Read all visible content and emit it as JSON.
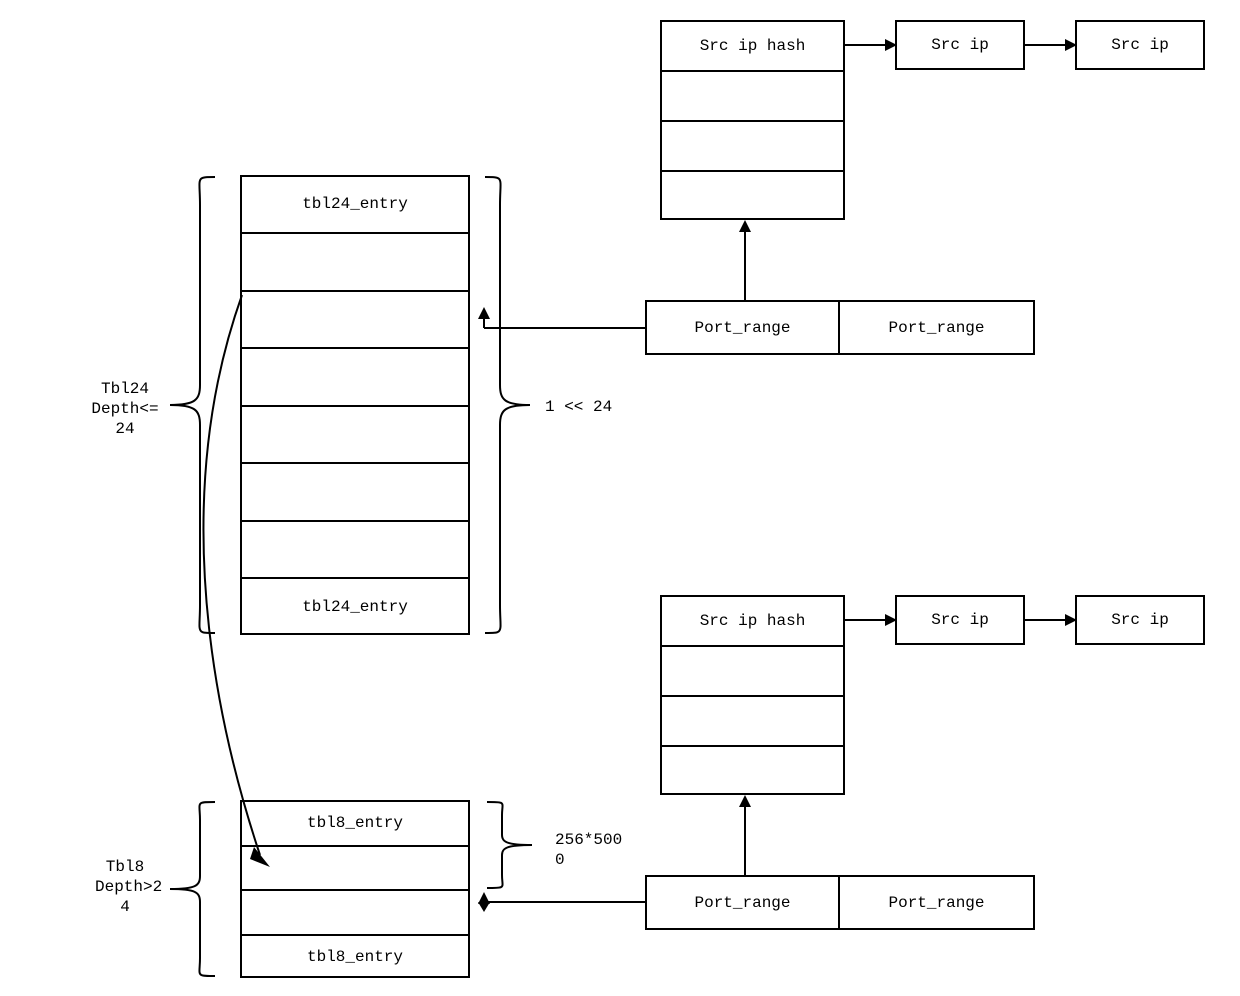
{
  "labels": {
    "tbl24_left": "Tbl24\nDepth<=\n24",
    "tbl8_left": "Tbl8\nDepth>2\n4",
    "tbl24_right": "1 << 24",
    "tbl8_right": "256*500\n0"
  },
  "tbl24": {
    "top_entry": "tbl24_entry",
    "bottom_entry": "tbl24_entry"
  },
  "tbl8": {
    "top_entry": "tbl8_entry",
    "bottom_entry": "tbl8_entry"
  },
  "top_chain": {
    "hash": "Src ip hash",
    "ip1": "Src ip",
    "ip2": "Src ip",
    "pr1": "Port_range",
    "pr2": "Port_range"
  },
  "bot_chain": {
    "hash": "Src ip hash",
    "ip1": "Src ip",
    "ip2": "Src ip",
    "pr1": "Port_range",
    "pr2": "Port_range"
  }
}
